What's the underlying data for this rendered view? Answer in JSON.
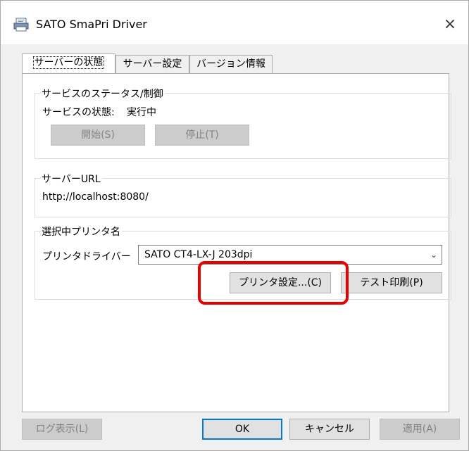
{
  "window": {
    "title": "SATO SmaPri Driver",
    "close_glyph": "×"
  },
  "tabs": [
    {
      "label": "サーバーの状態",
      "active": true
    },
    {
      "label": "サーバー設定",
      "active": false
    },
    {
      "label": "バージョン情報",
      "active": false
    }
  ],
  "service_group": {
    "title": "サービスのステータス/制御",
    "status_label": "サービスの状態:",
    "status_value": "実行中",
    "start_button": "開始(S)",
    "stop_button": "停止(T)"
  },
  "url_group": {
    "title": "サーバーURL",
    "url": "http://localhost:8080/"
  },
  "printer_group": {
    "title": "選択中プリンタ名",
    "driver_label": "プリンタドライバー",
    "driver_value": "SATO CT4-LX-J 203dpi",
    "settings_button": "プリンタ設定...(C)",
    "test_print_button": "テスト印刷(P)"
  },
  "footer": {
    "log_button": "ログ表示(L)",
    "ok_button": "OK",
    "cancel_button": "キャンセル",
    "apply_button": "適用(A)"
  },
  "colors": {
    "highlight": "#e60000",
    "focus": "#0078d7"
  },
  "icons": [
    "printer-icon",
    "close-icon",
    "chevron-down-icon"
  ]
}
